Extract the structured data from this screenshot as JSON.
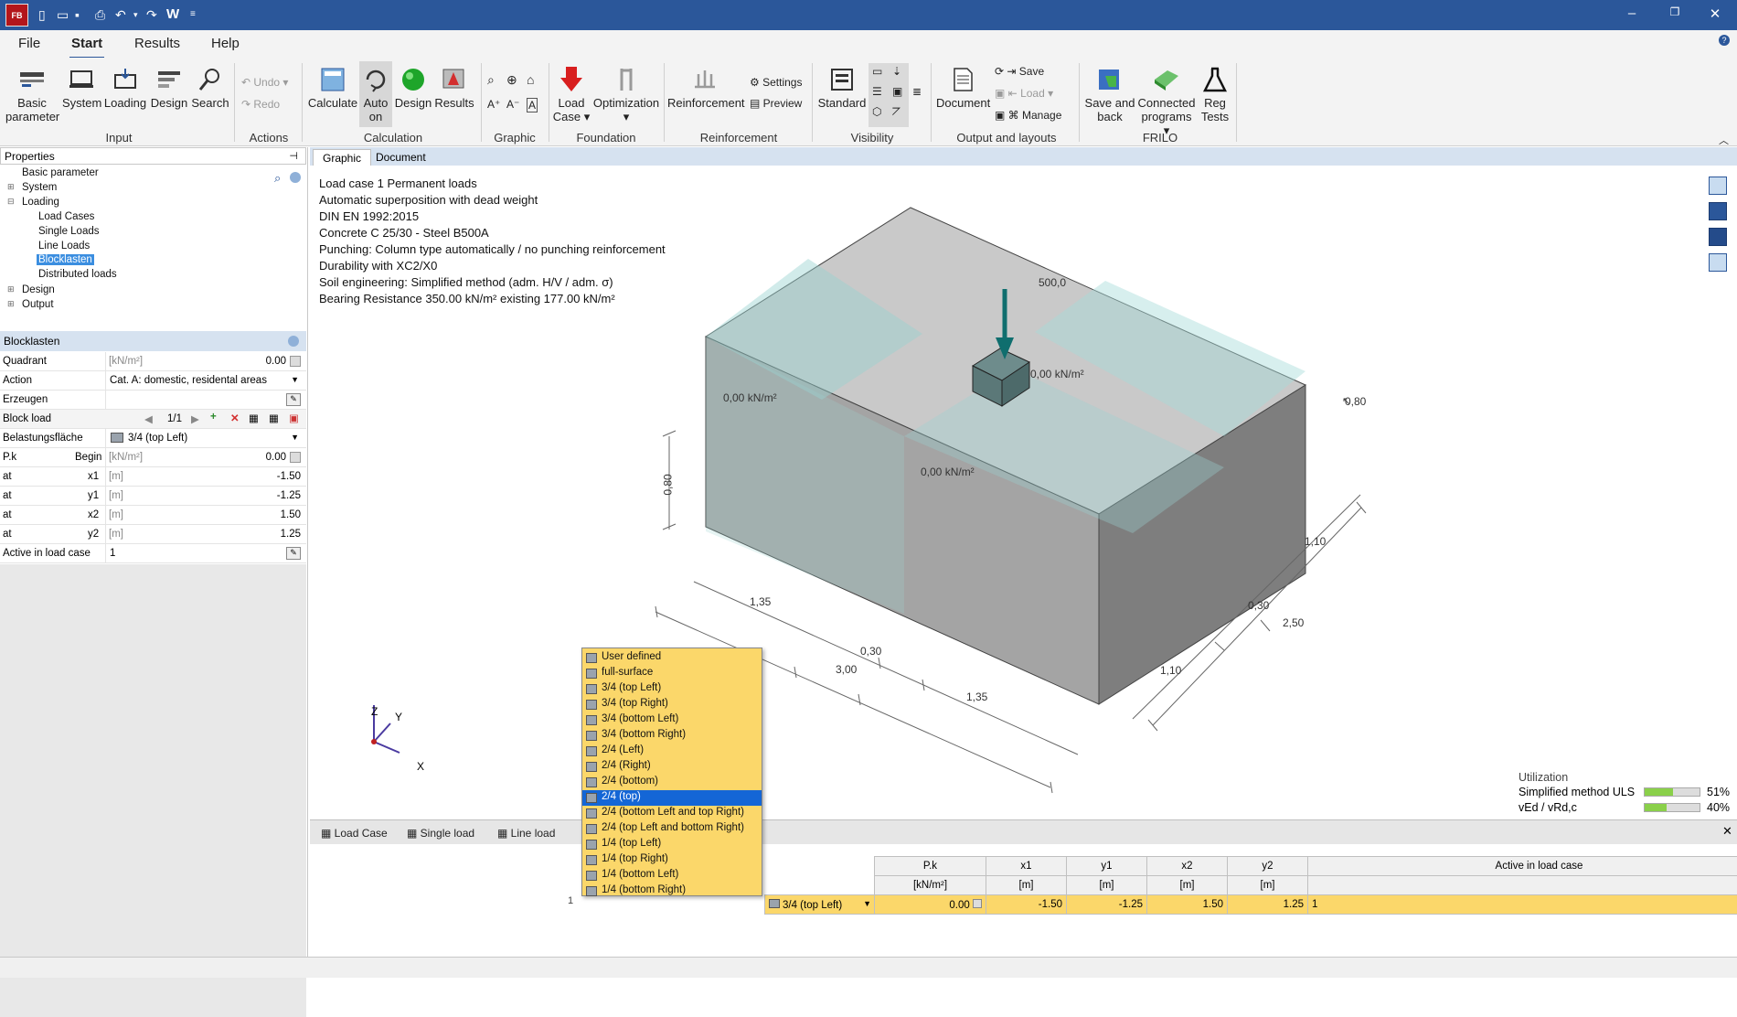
{
  "titlebar": {
    "app_icon": "FB",
    "w_label": "W"
  },
  "menu": {
    "tabs": [
      "File",
      "Start",
      "Results",
      "Help"
    ]
  },
  "ribbon": {
    "input": {
      "basic_parameter": "Basic parameter",
      "system": "System",
      "loading": "Loading",
      "design": "Design",
      "search": "Search",
      "group": "Input"
    },
    "actions": {
      "undo": "Undo",
      "redo": "Redo",
      "group": "Actions"
    },
    "calculation": {
      "calculate": "Calculate",
      "auto_on": "Auto on",
      "design": "Design",
      "results": "Results",
      "group": "Calculation"
    },
    "graphic": {
      "group": "Graphic"
    },
    "foundation": {
      "load_case": "Load Case",
      "optimization": "Optimization",
      "group": "Foundation"
    },
    "reinforcement": {
      "reinforcement": "Reinforcement",
      "settings": "Settings",
      "preview": "Preview",
      "group": "Reinforcement"
    },
    "visibility": {
      "standard": "Standard",
      "group": "Visibility"
    },
    "output": {
      "document": "Document",
      "save": "Save",
      "load": "Load",
      "manage": "Manage",
      "group": "Output and layouts"
    },
    "frilo": {
      "save_and_back": "Save and back",
      "connected_programs": "Connected programs",
      "reg_tests": "Reg Tests",
      "group": "FRILO"
    }
  },
  "properties": {
    "title": "Properties",
    "tree": [
      "Basic parameter",
      "System",
      "Loading",
      "Load Cases",
      "Single Loads",
      "Line Loads",
      "Blocklasten",
      "Distributed loads",
      "Design",
      "Output"
    ]
  },
  "blocklasten": {
    "title": "Blocklasten",
    "quadrant": {
      "label": "Quadrant",
      "unit": "[kN/m²]",
      "value": "0.00"
    },
    "action": {
      "label": "Action",
      "value": "Cat. A: domestic, residental areas"
    },
    "erzeugen": {
      "label": "Erzeugen"
    },
    "block_load": {
      "label": "Block load",
      "counter": "1/1"
    },
    "belastung": {
      "label": "Belastungsfläche",
      "value": "3/4 (top Left)"
    },
    "pk": {
      "label": "P.k",
      "label2": "Begin",
      "unit": "[kN/m²]",
      "value": "0.00"
    },
    "x1": {
      "label": "at",
      "label2": "x1",
      "unit": "[m]",
      "value": "-1.50"
    },
    "y1": {
      "label": "at",
      "label2": "y1",
      "unit": "[m]",
      "value": "-1.25"
    },
    "x2": {
      "label": "at",
      "label2": "x2",
      "unit": "[m]",
      "value": "1.50"
    },
    "y2": {
      "label": "at",
      "label2": "y2",
      "unit": "[m]",
      "value": "1.25"
    },
    "active": {
      "label": "Active in load case",
      "value": "1"
    }
  },
  "viewtabs": [
    "Graphic",
    "Document"
  ],
  "info": [
    "Load case 1 Permanent loads",
    "Automatic superposition with dead weight",
    "DIN EN 1992:2015",
    "Concrete C 25/30 - Steel B500A",
    "Punching: Column type automatically / no punching reinforcement",
    "Durability with XC2/X0",
    "Soil engineering: Simplified method (adm. H/V / adm. σ)",
    "Bearing Resistance 350.00 kN/m² existing 177.00 kN/m²"
  ],
  "drawing": {
    "load": "500,0",
    "q1": "0,00 kN/m²",
    "q2": "0,00 kN/m²",
    "q3": "0,00 kN/m²",
    "h": "0,80",
    "d_135a": "1,35",
    "d_030a": "0,30",
    "d_300": "3,00",
    "d_135b": "1,35",
    "d_110a": "1,10",
    "d_030b": "0,30",
    "d_250": "2,50",
    "d_110b": "1,10",
    "d_080b": "0,80",
    "ax": {
      "x": "X",
      "y": "Y",
      "z": "Z"
    }
  },
  "utilization": {
    "title": "Utilization",
    "rows": [
      {
        "label": "Simplified method ULS",
        "pct": "51%",
        "value": 0.51
      },
      {
        "label": "vEd / vRd,c",
        "pct": "40%",
        "value": 0.4
      }
    ]
  },
  "bottom": {
    "tabs": [
      "Load Case",
      "Single load",
      "Line load"
    ],
    "headers": [
      "P.k",
      "x1",
      "y1",
      "x2",
      "y2",
      "Active in load case"
    ],
    "units": [
      "[kN/m²]",
      "[m]",
      "[m]",
      "[m]",
      "[m]",
      ""
    ],
    "row": {
      "num": "1",
      "area": "3/4 (top Left)",
      "pk": "0.00",
      "x1": "-1.50",
      "y1": "-1.25",
      "x2": "1.50",
      "y2": "1.25",
      "active": "1"
    }
  },
  "dropdown": [
    "User defined",
    "full-surface",
    "3/4 (top Left)",
    "3/4 (top Right)",
    "3/4 (bottom Left)",
    "3/4 (bottom Right)",
    "2/4 (Left)",
    "2/4 (Right)",
    "2/4 (bottom)",
    "2/4 (top)",
    "2/4 (bottom Left and top Right)",
    "2/4 (top Left and bottom Right)",
    "1/4 (top Left)",
    "1/4 (top Right)",
    "1/4 (bottom Left)",
    "1/4 (bottom Right)"
  ],
  "dropdown_selected": 9,
  "colors": {
    "accent": "#2b579a",
    "dropdown_bg": "#fbd76a",
    "selected": "#1466d6",
    "column": "#0f6e6e"
  }
}
